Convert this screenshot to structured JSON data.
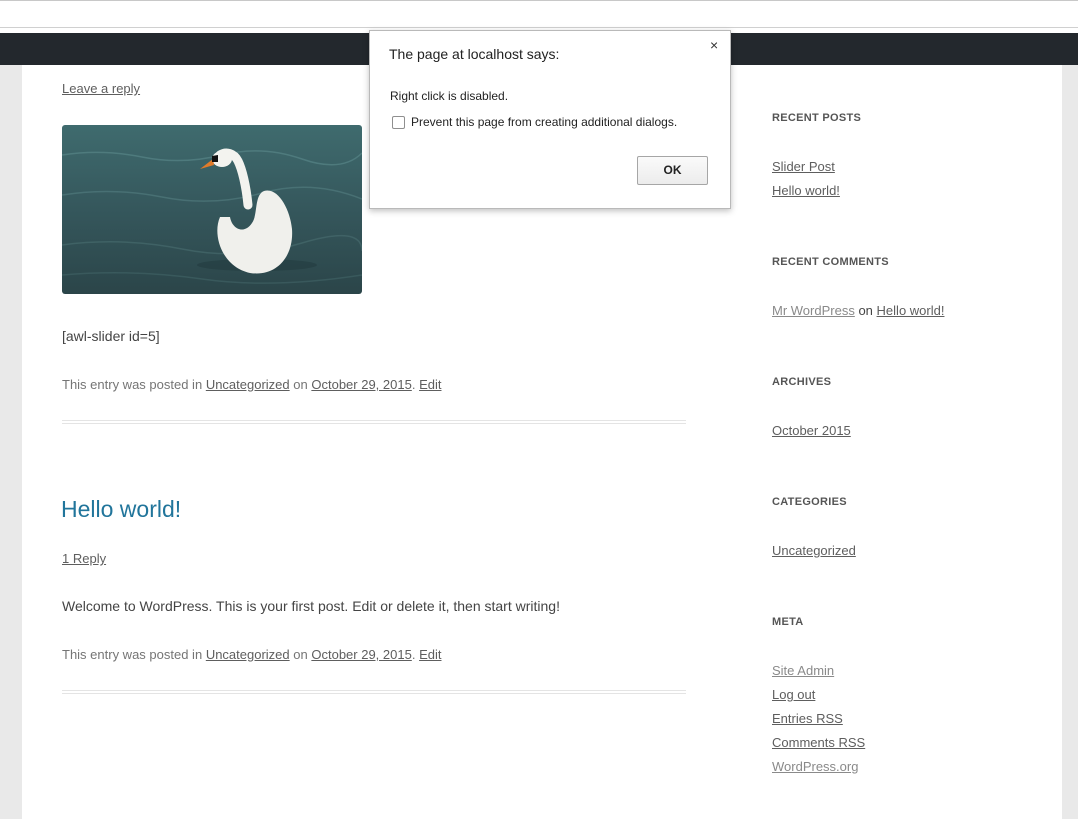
{
  "dialog": {
    "title": "The page at localhost says:",
    "close_glyph": "×",
    "message": "Right click is disabled.",
    "checkbox_label": "Prevent this page from creating additional dialogs.",
    "ok_label": "OK"
  },
  "post1": {
    "reply_link": "Leave a reply",
    "image_alt": "swan",
    "shortcode": "[awl-slider id=5]",
    "meta_prefix": "This entry was posted in",
    "category": "Uncategorized",
    "meta_on": "on",
    "date": "October 29, 2015",
    "period": ".",
    "edit": "Edit"
  },
  "post2": {
    "title": "Hello world!",
    "reply_link": "1 Reply",
    "content": "Welcome to WordPress. This is your first post. Edit or delete it, then start writing!",
    "meta_prefix": "This entry was posted in",
    "category": "Uncategorized",
    "meta_on": "on",
    "date": "October 29, 2015",
    "period": ".",
    "edit": "Edit"
  },
  "sidebar": {
    "recent_posts": {
      "title": "RECENT POSTS",
      "items": [
        "Slider Post",
        "Hello world!"
      ]
    },
    "recent_comments": {
      "title": "RECENT COMMENTS",
      "author": "Mr WordPress",
      "on": "on",
      "post": "Hello world!"
    },
    "archives": {
      "title": "ARCHIVES",
      "items": [
        "October 2015"
      ]
    },
    "categories": {
      "title": "CATEGORIES",
      "items": [
        "Uncategorized"
      ]
    },
    "meta": {
      "title": "META",
      "items": [
        "Site Admin",
        "Log out",
        "Entries RSS",
        "Comments RSS",
        "WordPress.org"
      ]
    }
  },
  "colors": {
    "admin_bar": "#23282d",
    "post_title": "#21759b",
    "page_background": "#e9e9e9"
  }
}
